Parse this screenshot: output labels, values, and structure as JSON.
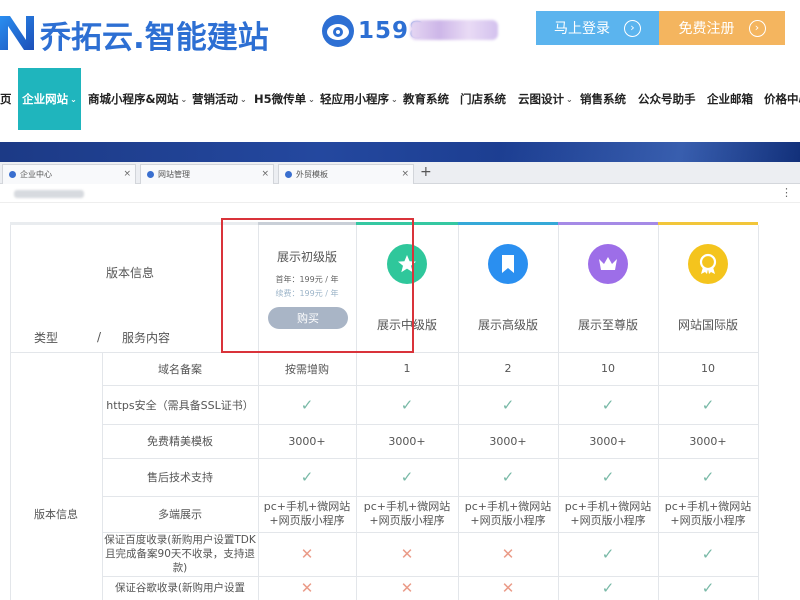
{
  "header": {
    "logo_text": "乔拓云.智能建站",
    "phone_visible": "1598",
    "login_label": "马上登录",
    "register_label": "免费注册"
  },
  "nav": {
    "items": [
      {
        "label": "页",
        "caret": false
      },
      {
        "label": "企业网站",
        "caret": true,
        "active": true
      },
      {
        "label": "商城小程序&网站",
        "caret": true
      },
      {
        "label": "营销活动",
        "caret": true
      },
      {
        "label": "H5微传单",
        "caret": true
      },
      {
        "label": "轻应用小程序",
        "caret": true
      },
      {
        "label": "教育系统",
        "caret": false
      },
      {
        "label": "门店系统",
        "caret": false
      },
      {
        "label": "云图设计",
        "caret": true
      },
      {
        "label": "销售系统",
        "caret": false
      },
      {
        "label": "公众号助手",
        "caret": false
      },
      {
        "label": "企业邮箱",
        "caret": false
      },
      {
        "label": "价格中心",
        "caret": false
      }
    ]
  },
  "browser": {
    "tabs": [
      {
        "label": "企业中心"
      },
      {
        "label": "网站管理"
      },
      {
        "label": "外贸模板"
      }
    ],
    "new_tab": "+",
    "menu": "⋮"
  },
  "pricing": {
    "header_label": "版本信息",
    "type_label": "类型",
    "slash": "/",
    "service_label": "服务内容",
    "basic": {
      "name": "展示初级版",
      "price_first": "首年：199元 / 年",
      "price_renew": "续费：199元 / 年",
      "buy_label": "购买"
    },
    "plans": [
      {
        "name": "展示中级版",
        "color": "#2fc79b",
        "icon": "star-icon"
      },
      {
        "name": "展示高级版",
        "color": "#2a8ff0",
        "icon": "bookmark-icon"
      },
      {
        "name": "展示至尊版",
        "color": "#9d6ee8",
        "icon": "crown-icon"
      },
      {
        "name": "网站国际版",
        "color": "#f4c41d",
        "icon": "medal-icon"
      }
    ],
    "group_label": "版本信息",
    "rows": [
      {
        "label": "域名备案",
        "values": [
          "按需增购",
          "1",
          "2",
          "10",
          "10"
        ]
      },
      {
        "label": "https安全（需具备SSL证书）",
        "values": [
          "✓",
          "✓",
          "✓",
          "✓",
          "✓"
        ]
      },
      {
        "label": "免费精美模板",
        "values": [
          "3000+",
          "3000+",
          "3000+",
          "3000+",
          "3000+"
        ]
      },
      {
        "label": "售后技术支持",
        "values": [
          "✓",
          "✓",
          "✓",
          "✓",
          "✓"
        ]
      },
      {
        "label": "多端展示",
        "values": [
          "pc+手机+微网站+网页版小程序",
          "pc+手机+微网站+网页版小程序",
          "pc+手机+微网站+网页版小程序",
          "pc+手机+微网站+网页版小程序",
          "pc+手机+微网站+网页版小程序"
        ]
      },
      {
        "label": "保证百度收录(新购用户设置TDK且完成备案90天不收录，支持退款)",
        "values": [
          "✕",
          "✕",
          "✕",
          "✓",
          "✓"
        ]
      },
      {
        "label": "保证谷歌收录(新购用户设置",
        "values": [
          "✕",
          "✕",
          "✕",
          "✓",
          "✓"
        ]
      }
    ]
  },
  "colors": {
    "brand_blue": "#2d6fd3",
    "login_btn": "#5bb4ee",
    "register_btn": "#f4b55f",
    "nav_active": "#1fb5bd",
    "check": "#79b9a7",
    "cross": "#ea9b88",
    "highlight_box": "#d9333a"
  }
}
